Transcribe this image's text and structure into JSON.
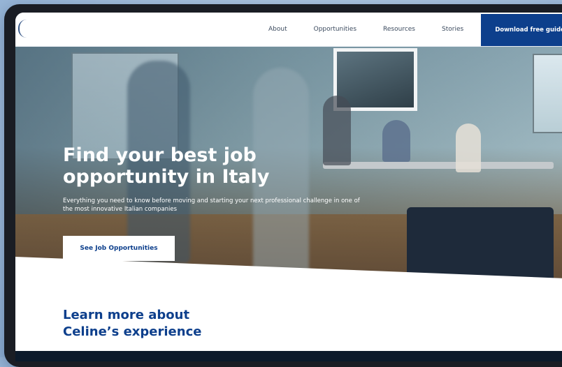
{
  "nav": {
    "links": [
      "About",
      "Opportunities",
      "Resources",
      "Stories"
    ],
    "cta_label": "Download free guide"
  },
  "hero": {
    "title": "Find your best job opportunity in Italy",
    "subtitle": "Everything you need to know before moving and starting your next professional challenge in one of the most innovative Italian companies",
    "button_label": "See Job Opportunities"
  },
  "section": {
    "heading_line1": "Learn more about",
    "heading_line2": "Celine’s experience"
  },
  "colors": {
    "brand_blue": "#0d3f8c",
    "device_frame": "#1a1d24"
  }
}
